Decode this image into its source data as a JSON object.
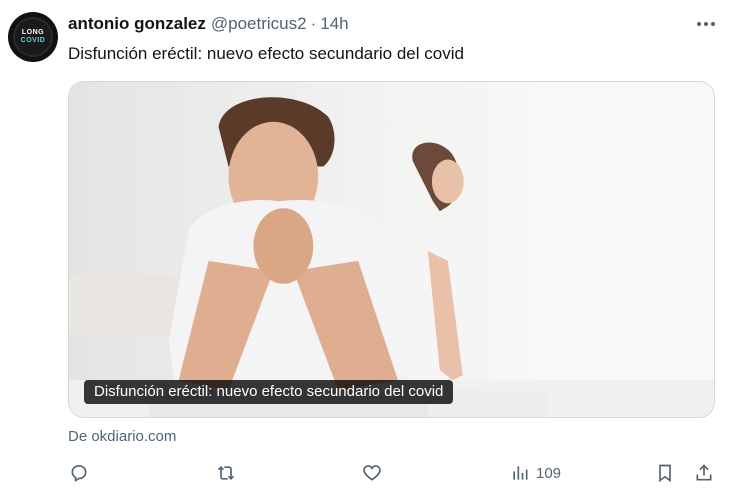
{
  "tweet": {
    "avatar": {
      "line1": "LONG",
      "line2": "COVID",
      "icon": "long-covid-logo"
    },
    "author_name": "antonio gonzalez",
    "handle": "@poetricus2",
    "separator": "·",
    "time": "14h",
    "more_icon": "more-horizontal-icon",
    "text": "Disfunción eréctil: nuevo efecto secundario del covid"
  },
  "card": {
    "title": "Disfunción eréctil: nuevo efecto secundario del covid",
    "source": "De okdiario.com"
  },
  "actions": {
    "reply_icon": "reply-icon",
    "retweet_icon": "retweet-icon",
    "like_icon": "heart-icon",
    "views_icon": "views-chart-icon",
    "views_count": "109",
    "bookmark_icon": "bookmark-icon",
    "share_icon": "share-icon"
  },
  "colors": {
    "text_primary": "#0f1419",
    "text_secondary": "#536471",
    "border": "#cfd9de"
  }
}
